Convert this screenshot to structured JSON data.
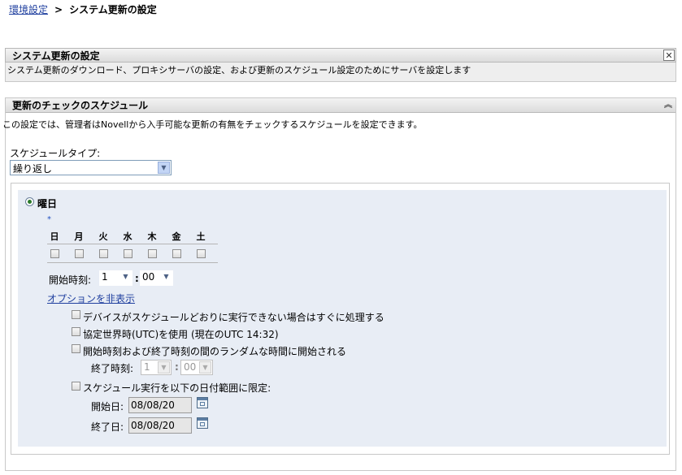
{
  "breadcrumb": {
    "link": "環境設定",
    "separator": ">",
    "current": "システム更新の設定"
  },
  "panel": {
    "title": "システム更新の設定",
    "description": "システム更新のダウンロード、プロキシサーバの設定、および更新のスケジュール設定のためにサーバを設定します",
    "close_label": "✕"
  },
  "section": {
    "title": "更新のチェックのスケジュール",
    "collapse_label": "︽",
    "description": "この設定では、管理者はNovellから入手可能な更新の有無をチェックするスケジュールを設定できます。"
  },
  "schedule": {
    "type_label": "スケジュールタイプ:",
    "type_value": "繰り返し",
    "radio_label": "曜日",
    "required_marker": "*",
    "days": [
      "日",
      "月",
      "火",
      "水",
      "木",
      "金",
      "土"
    ],
    "start_label": "開始時刻:",
    "start_hour": "1",
    "time_sep": ":",
    "start_minute": "00",
    "options_link": "オプションを非表示"
  },
  "options": {
    "process_immediately": "デバイスがスケジュールどおりに実行できない場合はすぐに処理する",
    "use_utc": "協定世界時(UTC)を使用 (現在のUTC 14:32)",
    "random_start": "開始時刻および終了時刻の間のランダムな時間に開始される",
    "end_time_label": "終了時刻:",
    "end_hour": "1",
    "end_minute": "00",
    "limit_range": "スケジュール実行を以下の日付範囲に限定:",
    "start_date_label": "開始日:",
    "start_date": "08/08/20",
    "end_date_label": "終了日:",
    "end_date": "08/08/20"
  }
}
